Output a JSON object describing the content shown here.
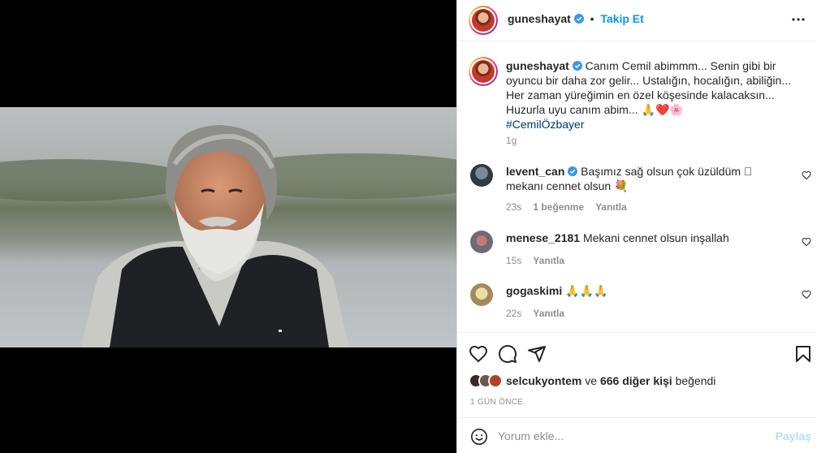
{
  "post": {
    "username": "guneshayat",
    "follow_label": "Takip Et",
    "caption_prefix": "Canım Cemil abimmm... Senin gibi bir oyuncu bir daha zor gelir... Ustalığın, hocalığın, abiliğin... Her zaman yüreğimin en özel köşesinde kalacaksın... Huzurla uyu canım abim... 🙏❤️🌸",
    "hashtag": "#CemilÖzbayer",
    "caption_time": "1g"
  },
  "comments": [
    {
      "username": "levent_can",
      "verified": true,
      "text": "Başımız sağ olsun çok üzüldüm 🏻 mekanı cennet olsun 💐",
      "time": "23s",
      "likes": "1 beğenme",
      "reply": "Yanıtla"
    },
    {
      "username": "menese_2181",
      "verified": false,
      "text": "Mekani cennet olsun inşallah",
      "time": "15s",
      "reply": "Yanıtla"
    },
    {
      "username": "gogaskimi",
      "verified": false,
      "text": "🙏🙏🙏",
      "time": "22s",
      "reply": "Yanıtla"
    }
  ],
  "likes": {
    "liker": "selcukyontem",
    "connector": "ve",
    "others": "666 diğer kişi",
    "suffix": "beğendi"
  },
  "posted_ago": "1 GÜN ÖNCE",
  "composer": {
    "placeholder": "Yorum ekle...",
    "share_label": "Paylaş"
  },
  "icons": [
    "more-options-icon",
    "heart-icon",
    "comment-icon",
    "share-icon",
    "bookmark-icon",
    "emoji-icon",
    "verified-icon"
  ],
  "colors": {
    "link": "#0095f6",
    "hashtag": "#00376b",
    "muted": "#8e8e8e",
    "border": "#dbdbdb"
  }
}
